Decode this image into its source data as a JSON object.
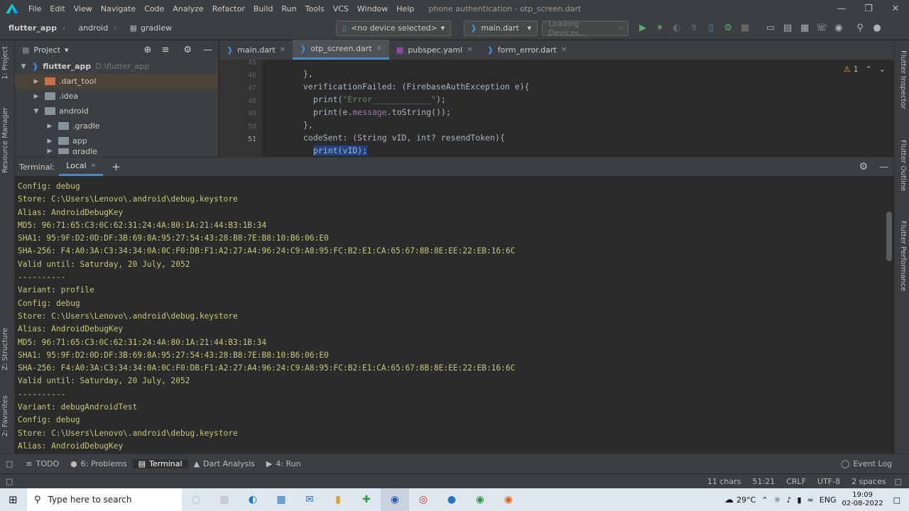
{
  "menubar": {
    "items": [
      "File",
      "Edit",
      "View",
      "Navigate",
      "Code",
      "Analyze",
      "Refactor",
      "Build",
      "Run",
      "Tools",
      "VCS",
      "Window",
      "Help"
    ],
    "title": "phone authentication - otp_screen.dart"
  },
  "navbar": {
    "breadcrumbs": [
      "flutter_app",
      "android",
      "gradlew"
    ],
    "device": "<no device selected>",
    "run_config": "main.dart",
    "loading": "Loading Devices..."
  },
  "left_tools": {
    "project": "1: Project",
    "resource_manager": "Resource Manager",
    "structure": "Z: Structure",
    "favorites": "2: Favorites"
  },
  "right_tools": {
    "inspector": "Flutter Inspector",
    "outline": "Flutter Outline",
    "performance": "Flutter Performance"
  },
  "project": {
    "header": "Project",
    "tree": [
      {
        "label": "flutter_app",
        "path": "D:\\flutter_app",
        "indent": 0,
        "expanded": true
      },
      {
        "label": ".dart_tool",
        "indent": 1,
        "expanded": false,
        "selected": true
      },
      {
        "label": ".idea",
        "indent": 1,
        "expanded": false
      },
      {
        "label": "android",
        "indent": 1,
        "expanded": true
      },
      {
        "label": ".gradle",
        "indent": 2,
        "expanded": false
      },
      {
        "label": "app",
        "indent": 2,
        "expanded": false
      },
      {
        "label": "gradle",
        "indent": 2,
        "expanded": false
      }
    ]
  },
  "editor": {
    "tabs": [
      {
        "label": "main.dart",
        "active": false
      },
      {
        "label": "otp_screen.dart",
        "active": true
      },
      {
        "label": "pubspec.yaml",
        "active": false
      },
      {
        "label": "form_error.dart",
        "active": false
      }
    ],
    "warnings": "1",
    "line_numbers": [
      "45",
      "46",
      "47",
      "48",
      "49",
      "50",
      "51"
    ],
    "lines": {
      "l45": "},",
      "l46": "verificationFailed: (FirebaseAuthException e){",
      "l47a": "print(",
      "l47b": "\"Error____________\"",
      "l47c": ");",
      "l48a": "print(e.",
      "l48b": "message",
      "l48c": ".toString());",
      "l49": "},",
      "l50": "codeSent: (String vID, int? resendToken){",
      "l51": "print(vID);"
    }
  },
  "terminal": {
    "label": "Terminal:",
    "tab": "Local",
    "add": "+",
    "output": [
      "Config: debug",
      "Store: C:\\Users\\Lenovo\\.android\\debug.keystore",
      "Alias: AndroidDebugKey",
      "MD5: 96:71:65:C3:0C:62:31:24:4A:80:1A:21:44:B3:1B:34",
      "SHA1: 95:9F:D2:0D:DF:3B:69:8A:95:27:54:43:28:B8:7E:B8:10:B6:06:E0",
      "SHA-256: F4:A0:3A:C3:34:34:0A:0C:F0:DB:F1:A2:27:A4:96:24:C9:A8:95:FC:B2:E1:CA:65:67:8B:8E:EE:22:EB:16:6C",
      "Valid until: Saturday, 20 July, 2052",
      "----------",
      "Variant: profile",
      "Config: debug",
      "Store: C:\\Users\\Lenovo\\.android\\debug.keystore",
      "Alias: AndroidDebugKey",
      "MD5: 96:71:65:C3:0C:62:31:24:4A:80:1A:21:44:B3:1B:34",
      "SHA1: 95:9F:D2:0D:DF:3B:69:8A:95:27:54:43:28:B8:7E:B8:10:B6:06:E0",
      "SHA-256: F4:A0:3A:C3:34:34:0A:0C:F0:DB:F1:A2:27:A4:96:24:C9:A8:95:FC:B2:E1:CA:65:67:8B:8E:EE:22:EB:16:6C",
      "Valid until: Saturday, 20 July, 2052",
      "----------",
      "Variant: debugAndroidTest",
      "Config: debug",
      "Store: C:\\Users\\Lenovo\\.android\\debug.keystore",
      "Alias: AndroidDebugKey"
    ]
  },
  "bottom_tabs": {
    "todo": "TODO",
    "problems": "6: Problems",
    "terminal": "Terminal",
    "dart_analysis": "Dart Analysis",
    "run": "4: Run",
    "event_log": "Event Log"
  },
  "status": {
    "chars": "11 chars",
    "position": "51:21",
    "line_sep": "CRLF",
    "encoding": "UTF-8",
    "indent": "2 spaces"
  },
  "taskbar": {
    "search_placeholder": "Type here to search",
    "temperature": "29°C",
    "language": "ENG",
    "time": "19:09",
    "date": "02-08-2022"
  },
  "colors": {
    "accent": "#4a88c7",
    "terminal_text": "#c8c878",
    "selection": "#214283"
  }
}
